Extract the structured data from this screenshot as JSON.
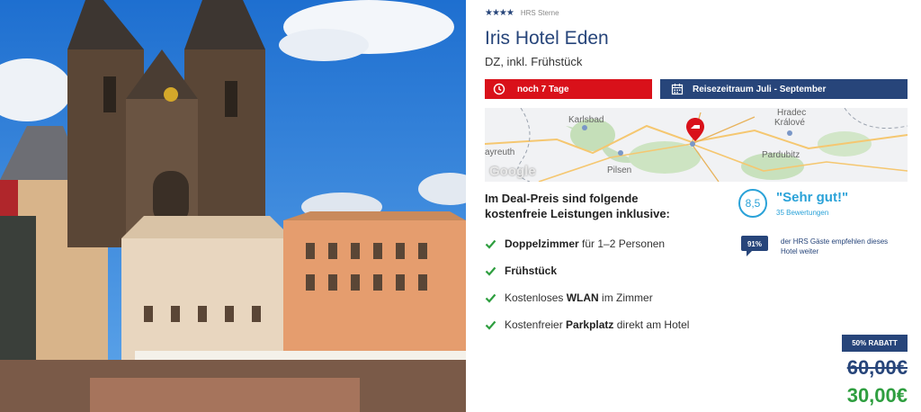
{
  "hotel": {
    "stars": "★★★★",
    "stars_label": "HRS Sterne",
    "name": "Iris Hotel Eden",
    "room_info": "DZ, inkl. Frühstück"
  },
  "badges": {
    "remaining": "noch 7 Tage",
    "period": "Reisezeitraum Juli - September"
  },
  "map": {
    "labels": [
      "Karlsbad",
      "Hradec",
      "Králové",
      "Pardubitz",
      "Pilsen",
      "ayreuth"
    ],
    "google": "Google"
  },
  "included": {
    "title": "Im Deal-Preis sind folgende kostenfreie Leistungen inklusive:",
    "items": [
      {
        "strong": "Doppelzimmer",
        "rest": " für 1–2 Personen"
      },
      {
        "strong": "Frühstück",
        "rest": ""
      },
      {
        "pre": "Kostenloses ",
        "strong": "WLAN",
        "rest": " im Zimmer"
      },
      {
        "pre": "Kostenfreier ",
        "strong": "Parkplatz",
        "rest": " direkt am Hotel"
      }
    ]
  },
  "rating": {
    "score": "8,5",
    "text": "\"Sehr gut!\"",
    "count": "35 Bewertungen"
  },
  "recommend": {
    "percent": "91%",
    "text": "der HRS Gäste empfehlen dieses Hotel weiter"
  },
  "pricing": {
    "discount": "50% RABATT",
    "old_price": "60,00€",
    "new_price": "30,00€"
  },
  "colors": {
    "brand_blue": "#27457a",
    "urgent_red": "#d9111a",
    "rating_cyan": "#2aa2d8",
    "price_green": "#2e9e3f"
  },
  "icons": [
    "clock-icon",
    "calendar-icon",
    "map-marker-icon",
    "check-icon",
    "speech-bubble-icon"
  ]
}
